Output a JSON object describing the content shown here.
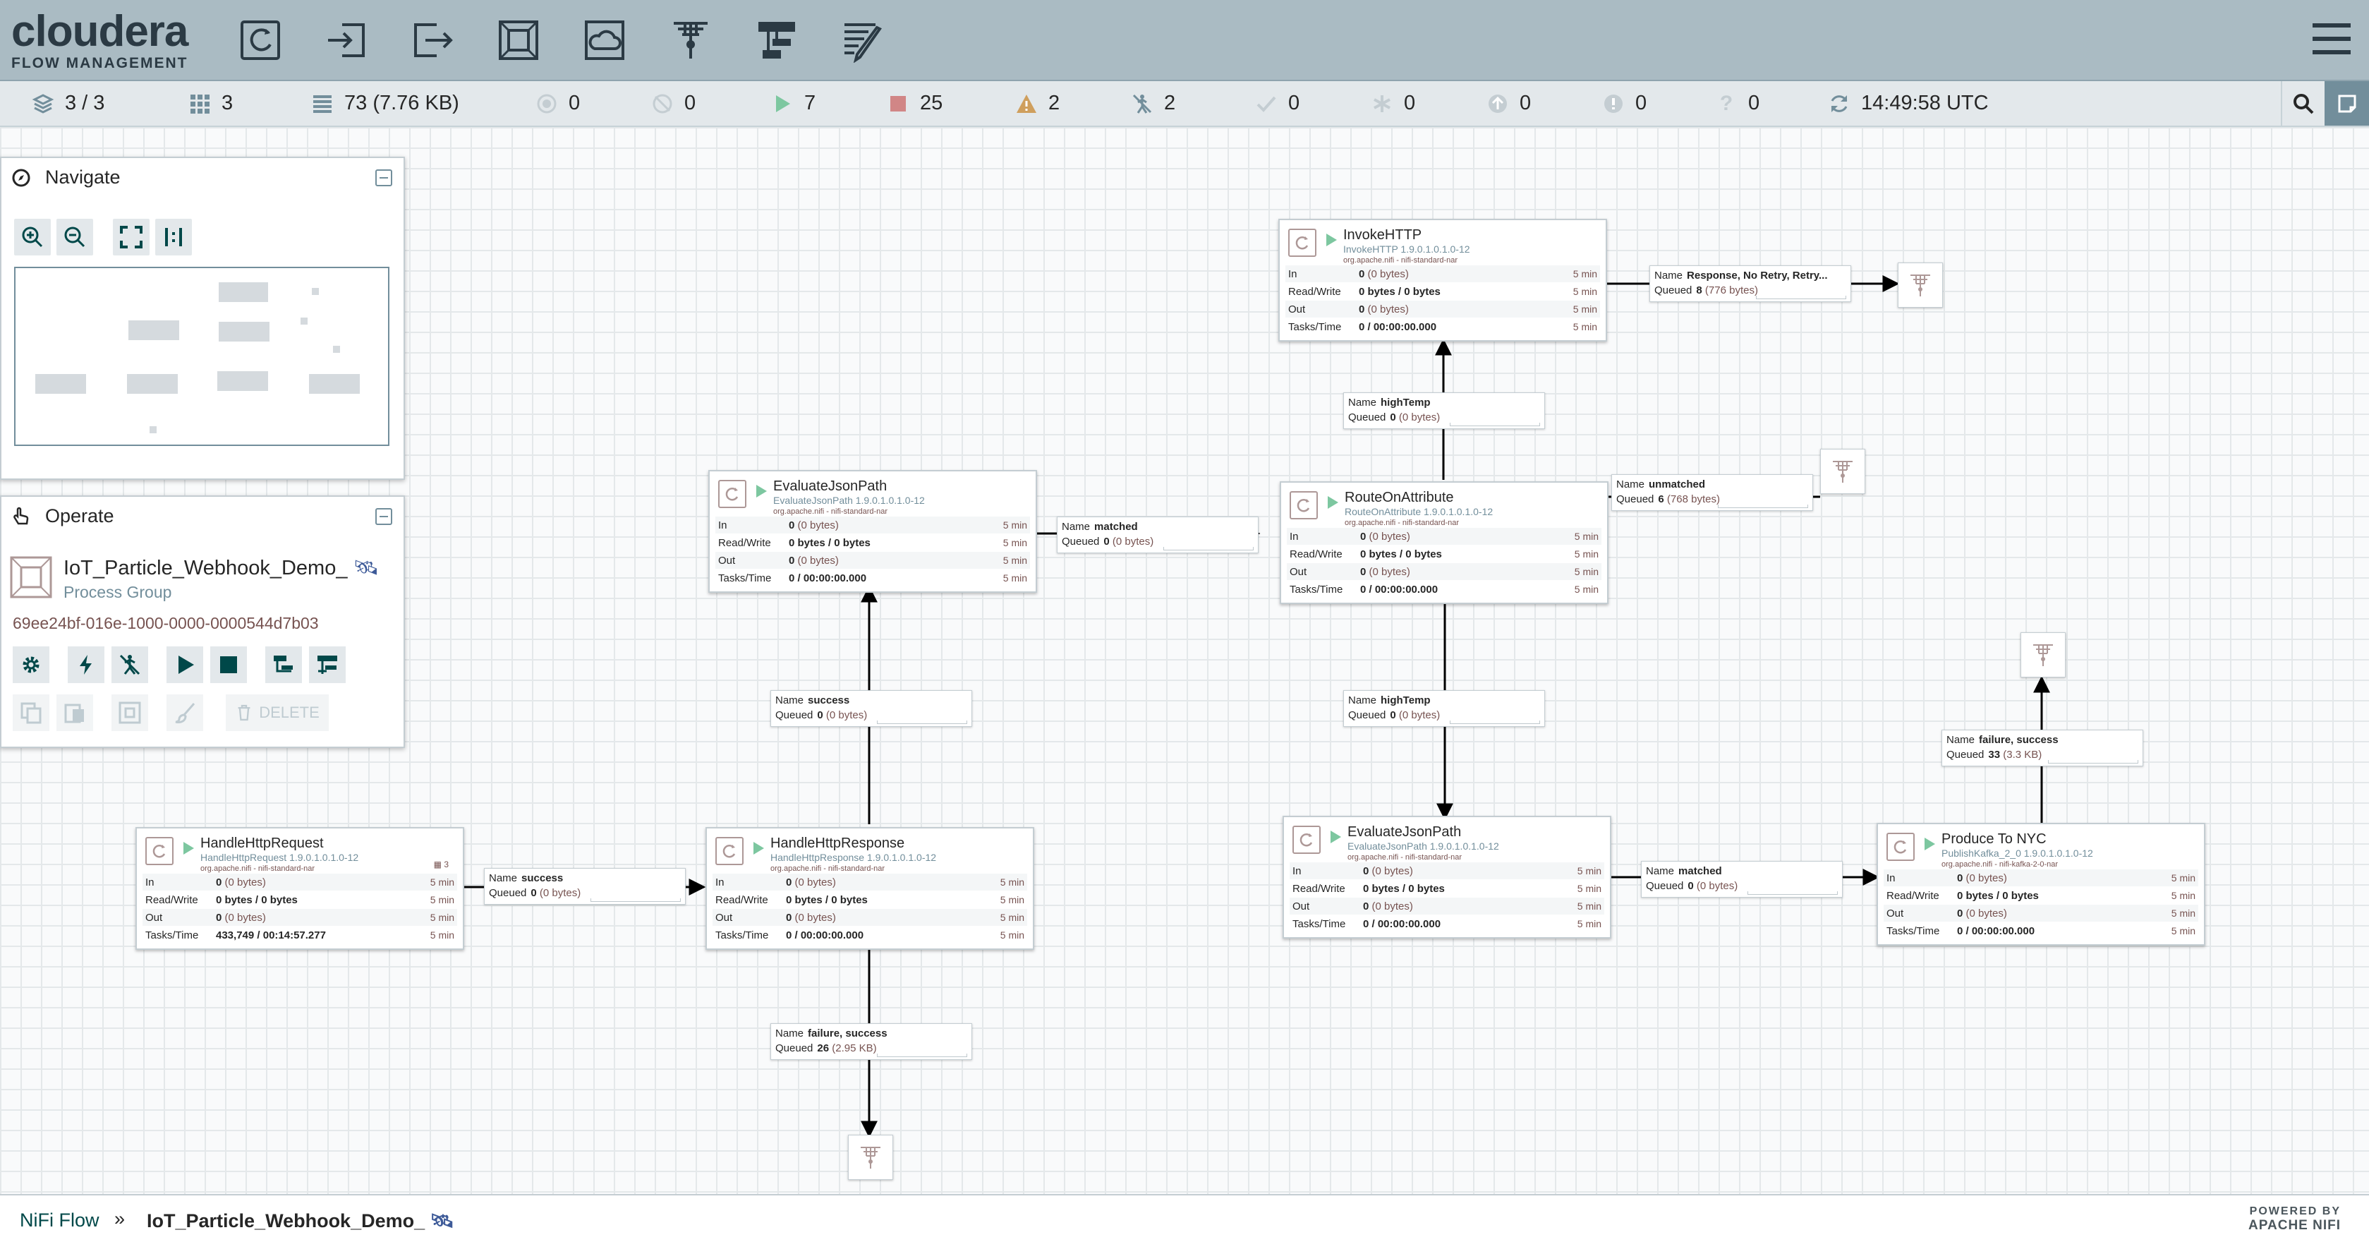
{
  "app": {
    "brand": "cloudera",
    "subtitle": "FLOW MANAGEMENT",
    "accent": "#728e9b",
    "header_bg": "#aabbc3"
  },
  "toolbar": {
    "tools": [
      {
        "name": "processor-tool",
        "icon": "processor-icon"
      },
      {
        "name": "input-port-tool",
        "icon": "input-port-icon"
      },
      {
        "name": "output-port-tool",
        "icon": "output-port-icon"
      },
      {
        "name": "process-group-tool",
        "icon": "process-group-icon"
      },
      {
        "name": "remote-process-group-tool",
        "icon": "remote-process-group-icon"
      },
      {
        "name": "funnel-tool",
        "icon": "funnel-icon"
      },
      {
        "name": "template-tool",
        "icon": "template-icon"
      },
      {
        "name": "label-tool",
        "icon": "label-icon"
      }
    ]
  },
  "status": {
    "cluster": "3 / 3",
    "threads": "3",
    "queued": "73 (7.76 KB)",
    "transmitting": "0",
    "not_transmitting": "0",
    "running": "7",
    "stopped": "25",
    "invalid": "2",
    "disabled": "2",
    "up_to_date": "0",
    "locally_modified": "0",
    "stale": "0",
    "locally_modified_stale": "0",
    "sync_failure": "0",
    "last_refreshed": "14:49:58 UTC"
  },
  "navigate": {
    "title": "Navigate"
  },
  "operate": {
    "title": "Operate",
    "group_name": "IoT_Particle_Webhook_Demo_",
    "group_type": "Process Group",
    "group_id": "69ee24bf-016e-1000-0000-0000544d7b03",
    "delete_label": "DELETE"
  },
  "labels": {
    "in": "In",
    "rw": "Read/Write",
    "out": "Out",
    "tasks": "Tasks/Time",
    "window": "5 min",
    "name": "Name",
    "queued": "Queued"
  },
  "processors": [
    {
      "id": "p-handlehttprequest",
      "name": "HandleHttpRequest",
      "type": "HandleHttpRequest 1.9.0.1.0.1.0-12",
      "bundle": "org.apache.nifi - nifi-standard-nar",
      "badge": "3",
      "in": "0",
      "in_sub": "(0 bytes)",
      "rw": "0 bytes / 0 bytes",
      "out": "0",
      "out_sub": "(0 bytes)",
      "tasks": "433,749 / 00:14:57.277"
    },
    {
      "id": "p-handlehttpresponse",
      "name": "HandleHttpResponse",
      "type": "HandleHttpResponse 1.9.0.1.0.1.0-12",
      "bundle": "org.apache.nifi - nifi-standard-nar",
      "badge": "",
      "in": "0",
      "in_sub": "(0 bytes)",
      "rw": "0 bytes / 0 bytes",
      "out": "0",
      "out_sub": "(0 bytes)",
      "tasks": "0 / 00:00:00.000"
    },
    {
      "id": "p-evaluatejsonpath-1",
      "name": "EvaluateJsonPath",
      "type": "EvaluateJsonPath 1.9.0.1.0.1.0-12",
      "bundle": "org.apache.nifi - nifi-standard-nar",
      "badge": "",
      "in": "0",
      "in_sub": "(0 bytes)",
      "rw": "0 bytes / 0 bytes",
      "out": "0",
      "out_sub": "(0 bytes)",
      "tasks": "0 / 00:00:00.000"
    },
    {
      "id": "p-invokehttp",
      "name": "InvokeHTTP",
      "type": "InvokeHTTP 1.9.0.1.0.1.0-12",
      "bundle": "org.apache.nifi - nifi-standard-nar",
      "badge": "",
      "in": "0",
      "in_sub": "(0 bytes)",
      "rw": "0 bytes / 0 bytes",
      "out": "0",
      "out_sub": "(0 bytes)",
      "tasks": "0 / 00:00:00.000"
    },
    {
      "id": "p-routeonattribute",
      "name": "RouteOnAttribute",
      "type": "RouteOnAttribute 1.9.0.1.0.1.0-12",
      "bundle": "org.apache.nifi - nifi-standard-nar",
      "badge": "",
      "in": "0",
      "in_sub": "(0 bytes)",
      "rw": "0 bytes / 0 bytes",
      "out": "0",
      "out_sub": "(0 bytes)",
      "tasks": "0 / 00:00:00.000"
    },
    {
      "id": "p-evaluatejsonpath-2",
      "name": "EvaluateJsonPath",
      "type": "EvaluateJsonPath 1.9.0.1.0.1.0-12",
      "bundle": "org.apache.nifi - nifi-standard-nar",
      "badge": "",
      "in": "0",
      "in_sub": "(0 bytes)",
      "rw": "0 bytes / 0 bytes",
      "out": "0",
      "out_sub": "(0 bytes)",
      "tasks": "0 / 00:00:00.000"
    },
    {
      "id": "p-produce-to-nyc",
      "name": "Produce To NYC",
      "type": "PublishKafka_2_0 1.9.0.1.0.1.0-12",
      "bundle": "org.apache.nifi - nifi-kafka-2-0-nar",
      "badge": "",
      "in": "0",
      "in_sub": "(0 bytes)",
      "rw": "0 bytes / 0 bytes",
      "out": "0",
      "out_sub": "(0 bytes)",
      "tasks": "0 / 00:00:00.000"
    }
  ],
  "connections": [
    {
      "rel": "success",
      "count": "0",
      "size": "(0 bytes)"
    },
    {
      "rel": "success",
      "count": "0",
      "size": "(0 bytes)"
    },
    {
      "rel": "failure, success",
      "count": "26",
      "size": "(2.95 KB)"
    },
    {
      "rel": "matched",
      "count": "0",
      "size": "(0 bytes)"
    },
    {
      "rel": "highTemp",
      "count": "0",
      "size": "(0 bytes)"
    },
    {
      "rel": "Response, No Retry, Retry...",
      "count": "8",
      "size": "(776 bytes)"
    },
    {
      "rel": "unmatched",
      "count": "6",
      "size": "(768 bytes)"
    },
    {
      "rel": "highTemp",
      "count": "0",
      "size": "(0 bytes)"
    },
    {
      "rel": "matched",
      "count": "0",
      "size": "(0 bytes)"
    },
    {
      "rel": "failure, success",
      "count": "33",
      "size": "(3.3 KB)"
    }
  ],
  "breadcrumb": {
    "root": "NiFi Flow",
    "separator": "»",
    "current": "IoT_Particle_Webhook_Demo_"
  },
  "footer": {
    "powered_by": "POWERED BY",
    "product": "APACHE NIFI"
  }
}
